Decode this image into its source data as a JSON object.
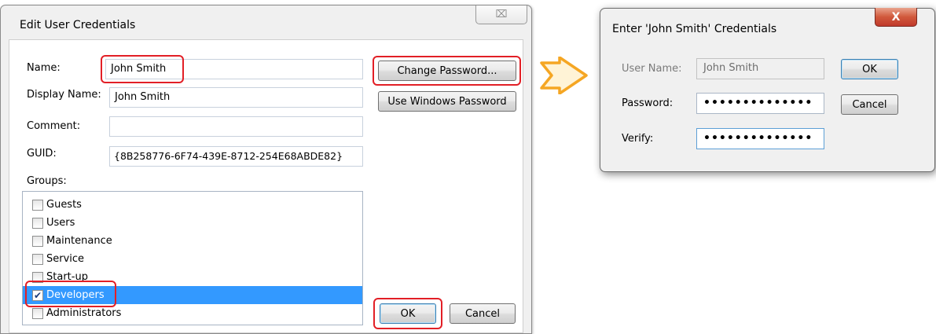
{
  "edit_dialog": {
    "title": "Edit User Credentials",
    "close_glyph": "⌧",
    "labels": {
      "name": "Name:",
      "display_name": "Display Name:",
      "comment": "Comment:",
      "guid": "GUID:",
      "groups": "Groups:"
    },
    "fields": {
      "name": "John Smith",
      "display_name": "John Smith",
      "comment": "",
      "guid": "{8B258776-6F74-439E-8712-254E68ABDE82}"
    },
    "buttons": {
      "change_password": "Change Password...",
      "use_windows_password": "Use Windows Password",
      "ok": "OK",
      "cancel": "Cancel"
    },
    "groups": [
      {
        "label": "Guests",
        "checked": false
      },
      {
        "label": "Users",
        "checked": false
      },
      {
        "label": "Maintenance",
        "checked": false
      },
      {
        "label": "Service",
        "checked": false
      },
      {
        "label": "Start-up",
        "checked": false
      },
      {
        "label": "Developers",
        "checked": true,
        "selected": true
      },
      {
        "label": "Administrators",
        "checked": false
      }
    ],
    "check_glyph": "✔"
  },
  "credentials_dialog": {
    "title": "Enter 'John Smith' Credentials",
    "close_glyph": "X",
    "labels": {
      "user_name": "User Name:",
      "password": "Password:",
      "verify": "Verify:"
    },
    "fields": {
      "user_name": "John Smith",
      "password": "••••••••••••••",
      "verify": "••••••••••••••"
    },
    "buttons": {
      "ok": "OK",
      "cancel": "Cancel"
    }
  },
  "colors": {
    "highlight": "#e21f26",
    "arrow": "#f5a623",
    "selection": "#3399ff"
  },
  "icons": {
    "arrow": "right-arrow-icon"
  }
}
